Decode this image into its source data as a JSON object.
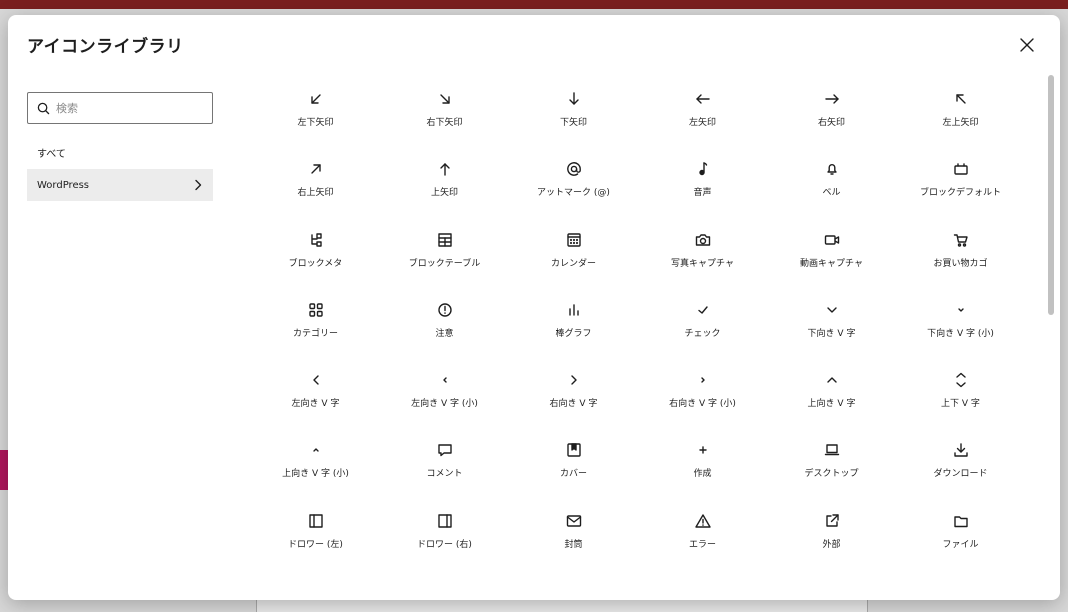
{
  "modal": {
    "title": "アイコンライブラリ",
    "close_icon": "close-icon"
  },
  "sidebar": {
    "search": {
      "placeholder": "検索",
      "value": ""
    },
    "categories": [
      {
        "label": "すべて",
        "selected": false
      },
      {
        "label": "WordPress",
        "selected": true
      }
    ]
  },
  "icons": [
    {
      "label": "左下矢印",
      "icon": "arrow-down-left-icon"
    },
    {
      "label": "右下矢印",
      "icon": "arrow-down-right-icon"
    },
    {
      "label": "下矢印",
      "icon": "arrow-down-icon"
    },
    {
      "label": "左矢印",
      "icon": "arrow-left-icon"
    },
    {
      "label": "右矢印",
      "icon": "arrow-right-icon"
    },
    {
      "label": "左上矢印",
      "icon": "arrow-up-left-icon"
    },
    {
      "label": "右上矢印",
      "icon": "arrow-up-right-icon"
    },
    {
      "label": "上矢印",
      "icon": "arrow-up-icon"
    },
    {
      "label": "アットマーク (@)",
      "icon": "at-symbol-icon"
    },
    {
      "label": "音声",
      "icon": "audio-icon"
    },
    {
      "label": "ベル",
      "icon": "bell-icon"
    },
    {
      "label": "ブロックデフォルト",
      "icon": "block-default-icon"
    },
    {
      "label": "ブロックメタ",
      "icon": "block-meta-icon"
    },
    {
      "label": "ブロックテーブル",
      "icon": "block-table-icon"
    },
    {
      "label": "カレンダー",
      "icon": "calendar-icon"
    },
    {
      "label": "写真キャプチャ",
      "icon": "camera-icon"
    },
    {
      "label": "動画キャプチャ",
      "icon": "video-camera-icon"
    },
    {
      "label": "お買い物カゴ",
      "icon": "shopping-cart-icon"
    },
    {
      "label": "カテゴリー",
      "icon": "category-icon"
    },
    {
      "label": "注意",
      "icon": "caution-icon"
    },
    {
      "label": "棒グラフ",
      "icon": "bar-chart-icon"
    },
    {
      "label": "チェック",
      "icon": "check-icon"
    },
    {
      "label": "下向き V 字",
      "icon": "chevron-down-icon"
    },
    {
      "label": "下向き V 字 (小)",
      "icon": "chevron-down-small-icon"
    },
    {
      "label": "左向き V 字",
      "icon": "chevron-left-icon"
    },
    {
      "label": "左向き V 字 (小)",
      "icon": "chevron-left-small-icon"
    },
    {
      "label": "右向き V 字",
      "icon": "chevron-right-icon"
    },
    {
      "label": "右向き V 字 (小)",
      "icon": "chevron-right-small-icon"
    },
    {
      "label": "上向き V 字",
      "icon": "chevron-up-icon"
    },
    {
      "label": "上下 V 字",
      "icon": "chevron-up-down-icon"
    },
    {
      "label": "上向き V 字 (小)",
      "icon": "chevron-up-small-icon"
    },
    {
      "label": "コメント",
      "icon": "comment-icon"
    },
    {
      "label": "カバー",
      "icon": "cover-icon"
    },
    {
      "label": "作成",
      "icon": "create-icon"
    },
    {
      "label": "デスクトップ",
      "icon": "desktop-icon"
    },
    {
      "label": "ダウンロード",
      "icon": "download-icon"
    },
    {
      "label": "ドロワー (左)",
      "icon": "drawer-left-icon"
    },
    {
      "label": "ドロワー (右)",
      "icon": "drawer-right-icon"
    },
    {
      "label": "封筒",
      "icon": "envelope-icon"
    },
    {
      "label": "エラー",
      "icon": "error-icon"
    },
    {
      "label": "外部",
      "icon": "external-icon"
    },
    {
      "label": "ファイル",
      "icon": "file-icon"
    }
  ]
}
